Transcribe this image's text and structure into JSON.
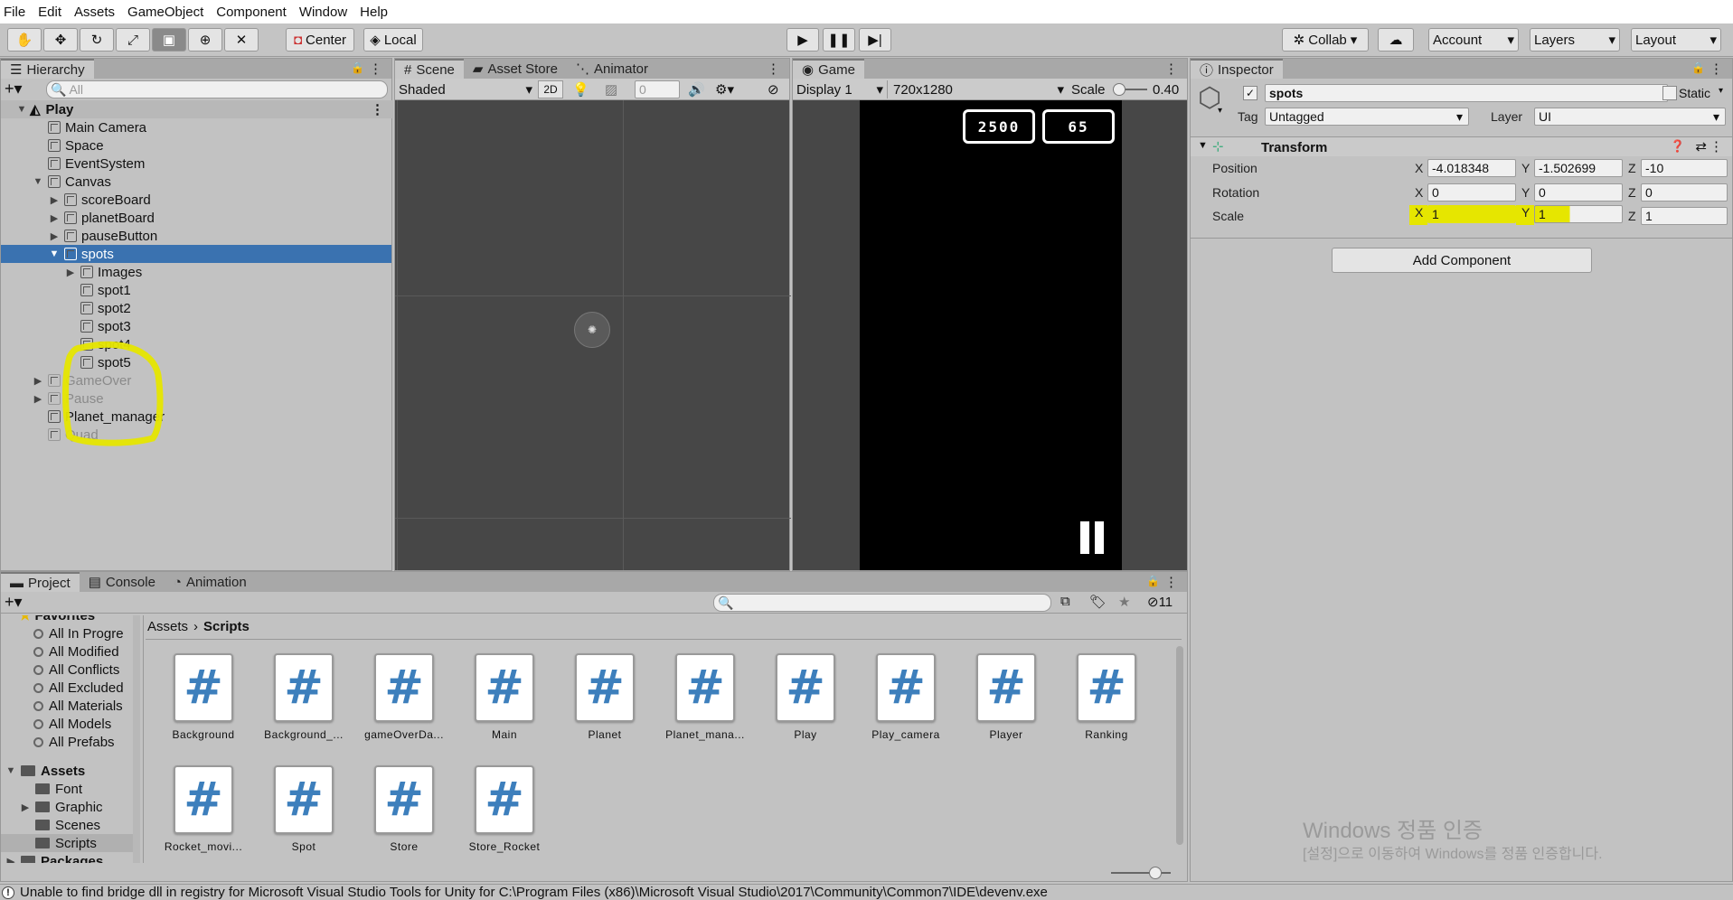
{
  "menu": [
    "File",
    "Edit",
    "Assets",
    "GameObject",
    "Component",
    "Window",
    "Help"
  ],
  "toolbar": {
    "center_label": "Center",
    "local_label": "Local",
    "collab_label": "Collab",
    "account_label": "Account",
    "layers_label": "Layers",
    "layout_label": "Layout"
  },
  "hierarchy": {
    "tab": "Hierarchy",
    "search_placeholder": "All",
    "scene": "Play",
    "items": [
      "Main Camera",
      "Space",
      "EventSystem",
      "Canvas",
      "scoreBoard",
      "planetBoard",
      "pauseButton",
      "spots",
      "Images",
      "spot1",
      "spot2",
      "spot3",
      "spot4",
      "spot5",
      "GameOver",
      "Pause",
      "Planet_manager",
      "Quad"
    ]
  },
  "scene": {
    "tabs": [
      "Scene",
      "Asset Store",
      "Animator"
    ],
    "shading": "Shaded",
    "mode2d": "2D",
    "gizmo_count": "0"
  },
  "game": {
    "tab": "Game",
    "display": "Display 1",
    "resolution": "720x1280",
    "scale_label": "Scale",
    "scale_value": "0.40",
    "score": "2500",
    "planets": "65"
  },
  "inspector": {
    "tab": "Inspector",
    "object_name": "spots",
    "static_label": "Static",
    "tag_label": "Tag",
    "tag_value": "Untagged",
    "layer_label": "Layer",
    "layer_value": "UI",
    "component": "Transform",
    "position_label": "Position",
    "rotation_label": "Rotation",
    "scale_label": "Scale",
    "axis_x": "X",
    "axis_y": "Y",
    "axis_z": "Z",
    "pos": [
      "-4.018348",
      "-1.502699",
      "-10"
    ],
    "rot": [
      "0",
      "0",
      "0"
    ],
    "scl": [
      "1",
      "1",
      "1"
    ],
    "add_component": "Add Component"
  },
  "project": {
    "tabs": [
      "Project",
      "Console",
      "Animation"
    ],
    "hidden_count": "11",
    "favorites_label": "Favorites",
    "favorites": [
      "All In Progre",
      "All Modified",
      "All Conflicts",
      "All Excluded",
      "All Materials",
      "All Models",
      "All Prefabs"
    ],
    "assets_label": "Assets",
    "folders": [
      "Font",
      "Graphic",
      "Scenes",
      "Scripts"
    ],
    "packages_label": "Packages",
    "breadcrumb": [
      "Assets",
      "Scripts"
    ],
    "scripts": [
      "Background",
      "Background_...",
      "gameOverDa...",
      "Main",
      "Planet",
      "Planet_mana...",
      "Play",
      "Play_camera",
      "Player",
      "Ranking",
      "Rocket_movi...",
      "Spot",
      "Store",
      "Store_Rocket"
    ]
  },
  "watermark": {
    "line1": "Windows 정품 인증",
    "line2": "[설정]으로 이동하여 Windows를 정품 인증합니다."
  },
  "status": "Unable to find bridge dll in registry for Microsoft Visual Studio Tools for Unity for C:\\Program Files (x86)\\Microsoft Visual Studio\\2017\\Community\\Common7\\IDE\\devenv.exe",
  "colors": {
    "highlight": "#e6e600",
    "selection": "#3a72b0",
    "script_icon": "#3d7fbc"
  }
}
